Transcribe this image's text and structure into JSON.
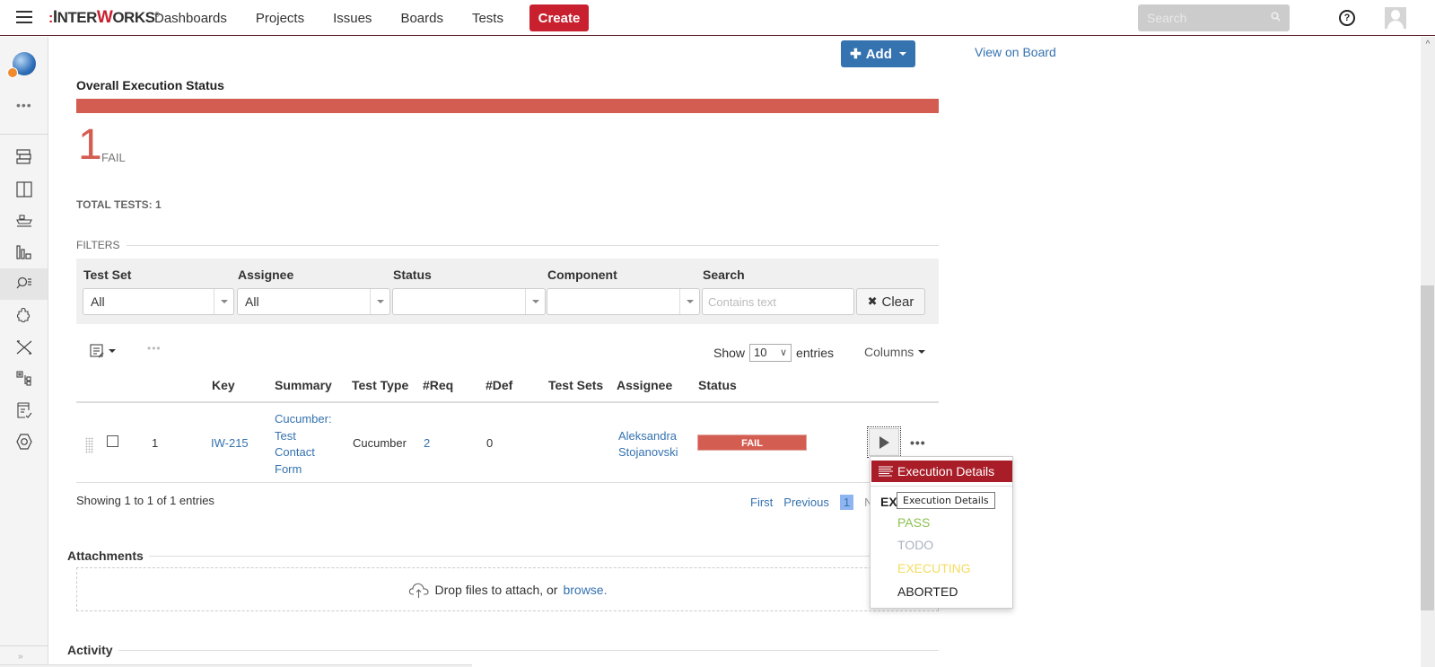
{
  "topnav": {
    "logo": {
      "dots": ":",
      "i": "I",
      "nter": "NTER",
      "w": "W",
      "orks": "ORKS",
      "mark": "®"
    },
    "items": [
      "Dashboards",
      "Projects",
      "Issues",
      "Boards",
      "Tests"
    ],
    "create_label": "Create",
    "search_placeholder": "Search",
    "help_glyph": "?",
    "brand_color": "#c8202f"
  },
  "sidebar": {
    "more_glyph": "•••",
    "icons": [
      "backlog-icon",
      "board-icon",
      "releases-icon",
      "reports-icon",
      "test-search-icon",
      "components-icon",
      "xray-icon",
      "test-repository-icon",
      "test-plan-icon",
      "settings-hex-icon"
    ],
    "active_icon": "test-search-icon",
    "collapse_glyph": "»"
  },
  "header": {
    "add_label": "Add",
    "add_glyph": "✚",
    "view_on_board": "View on Board"
  },
  "execution_status": {
    "title": "Overall Execution Status",
    "fail_fraction": 1.0,
    "fail_count": "1",
    "fail_label": "FAIL",
    "total_tests": "TOTAL TESTS: 1",
    "fail_color": "#d45d52"
  },
  "filters": {
    "legend": "FILTERS",
    "test_set": {
      "label": "Test Set",
      "value": "All"
    },
    "assignee": {
      "label": "Assignee",
      "value": "All"
    },
    "status": {
      "label": "Status",
      "value": ""
    },
    "component": {
      "label": "Component",
      "value": ""
    },
    "search": {
      "label": "Search",
      "placeholder": "Contains text",
      "value": ""
    },
    "clear_label": "Clear",
    "clear_glyph": "✖"
  },
  "table": {
    "toolbar_more": "•••",
    "show_label": "Show",
    "page_length": "10",
    "entries_label": "entries",
    "columns_label": "Columns",
    "headers": [
      "Key",
      "Summary",
      "Test Type",
      "#Req",
      "#Def",
      "Test Sets",
      "Assignee",
      "Status"
    ],
    "rows": [
      {
        "index": "1",
        "key": "IW-215",
        "summary_lines": [
          "Cucumber:",
          "Test",
          "Contact",
          "Form"
        ],
        "test_type": "Cucumber",
        "req": "2",
        "def": "0",
        "test_sets": "",
        "assignee_lines": [
          "Aleksandra",
          "Stojanovski"
        ],
        "status": "FAIL"
      }
    ],
    "row_more": "•••",
    "showing": "Showing 1 to 1 of 1 entries",
    "pager": {
      "first": "First",
      "previous": "Previous",
      "current": "1",
      "next_partial": "N"
    }
  },
  "dropdown": {
    "active_item": "Execution Details",
    "section_head": "EX",
    "items": [
      {
        "label": "PASS",
        "color": "#8cc152"
      },
      {
        "label": "TODO",
        "color": "#a9b3c0"
      },
      {
        "label": "EXECUTING",
        "color": "#f4dc5f"
      },
      {
        "label": "ABORTED",
        "color": "#222222"
      }
    ],
    "tooltip": "Execution Details"
  },
  "attachments": {
    "title": "Attachments",
    "drop_text": "Drop files to attach, or",
    "browse_link": "browse."
  },
  "activity": {
    "title": "Activity"
  }
}
